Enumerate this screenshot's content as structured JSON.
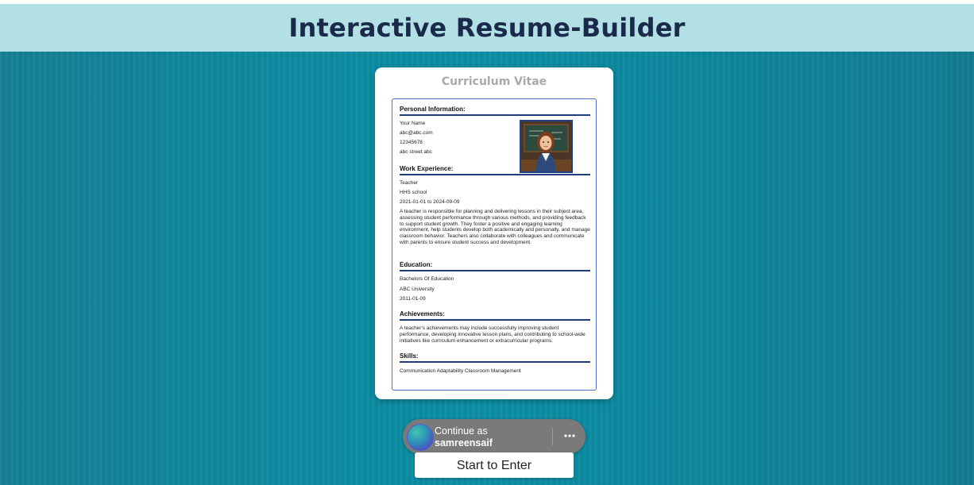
{
  "header": {
    "title": "Interactive Resume-Builder"
  },
  "card": {
    "title": "Curriculum Vitae",
    "personal": {
      "heading": "Personal Information:",
      "name": "Your Name",
      "email": "abc@abc.com",
      "phone": "12345678",
      "address": "abc street abc"
    },
    "work": {
      "heading": "Work Experience:",
      "role": "Teacher",
      "company": "HHS school",
      "dates": "2021-01-01 to 2024-09-09",
      "description": "A teacher is responsible for planning and delivering lessons in their subject area, assessing student performance through various methods, and providing feedback to support student growth. They foster a positive and engaging learning environment, help students develop both academically and personally, and manage classroom behavior. Teachers also collaborate with colleagues and communicate with parents to ensure student success and development."
    },
    "education": {
      "heading": "Education:",
      "degree": "Bachelors Of Education",
      "institution": "ABC University",
      "date": "2011-01-09"
    },
    "achievements": {
      "heading": "Achievements:",
      "text": "A teacher's achievements may include successfully improving student performance, developing innovative lesson plans, and contributing to school-wide initiatives like curriculum enhancement or extracurricular programs."
    },
    "skills": {
      "heading": "Skills:",
      "text": "Communication Adaptability Classroom Management"
    }
  },
  "google_prompt": {
    "line1": "Continue as",
    "username": "samreensaif",
    "more_icon": "more-horizontal-icon"
  },
  "cta": {
    "start_label": "Start to Enter"
  },
  "colors": {
    "header_bg": "#b3e0e5",
    "page_bg": "#0c8ea4",
    "rule": "#1f3d7a",
    "cv_border": "#4a72c9"
  }
}
